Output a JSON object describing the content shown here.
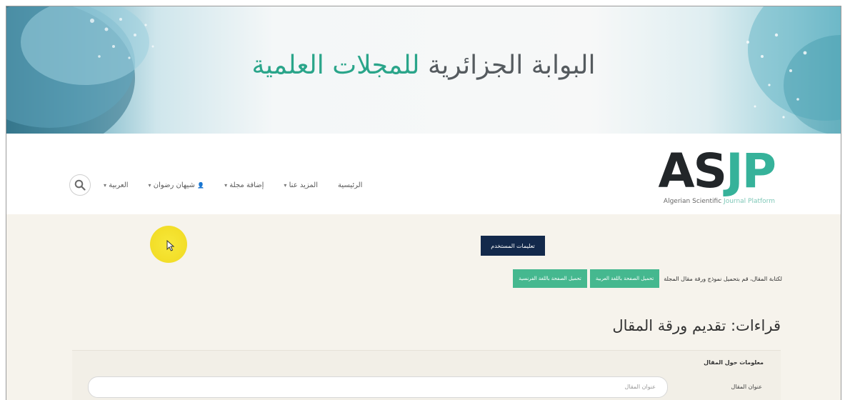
{
  "banner": {
    "title_part1": "البوابة الجزائرية",
    "title_part2": "للمجلات العلمية"
  },
  "logo": {
    "text_as": "AS",
    "text_jp": "JP",
    "subtitle_dark": "Algerian Scientific",
    "subtitle_light": "Journal Platform"
  },
  "nav": {
    "items": [
      "الرئيسية",
      "المزيد عنا",
      "إضافة مجلة",
      "شيهان رضوان",
      "العربية"
    ],
    "search_icon": "search-icon",
    "user_icon": "user-icon"
  },
  "content": {
    "instructions_button": "تعليمات المستخدم",
    "notice_text": "لكتابة المقال، قم بتحميل نموذج ورقة مقال المجلة",
    "download_arabic_button": "تحميل الصفحة باللغة العربية",
    "download_french_button": "تحميل الصفحة باللغة الفرنسية",
    "page_heading": "قراءات: تقديم ورقة المقال",
    "section_label": "معلومات حول المقال",
    "title_field_label": "عنوان المقال",
    "title_field_placeholder": "عنوان المقال"
  },
  "colors": {
    "accent_green": "#45b88f",
    "logo_green": "#36b29a",
    "dark_button": "#13294b",
    "highlight_cursor": "#f3df2a"
  }
}
